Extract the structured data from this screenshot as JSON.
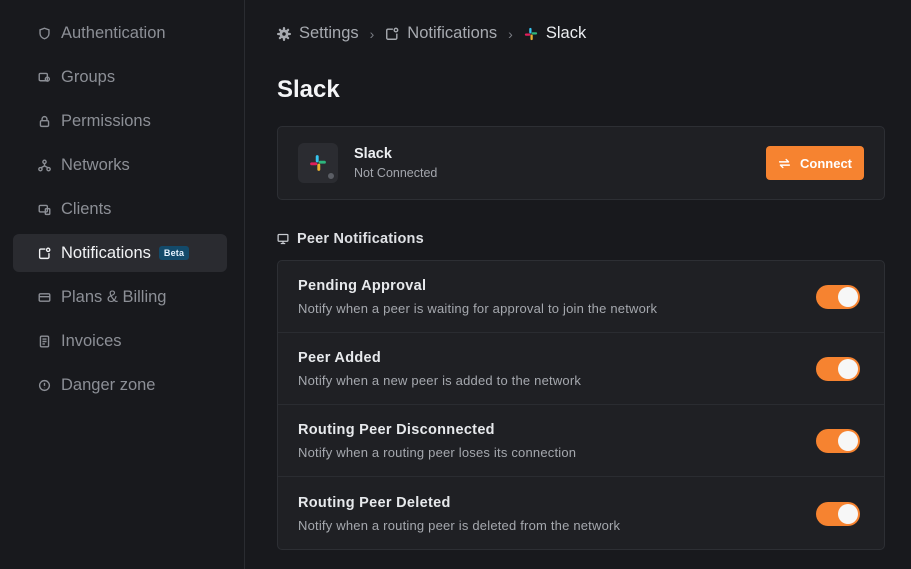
{
  "sidebar": {
    "items": [
      {
        "label": "Authentication",
        "icon": "shield-icon"
      },
      {
        "label": "Groups",
        "icon": "groups-icon"
      },
      {
        "label": "Permissions",
        "icon": "lock-icon"
      },
      {
        "label": "Networks",
        "icon": "network-icon"
      },
      {
        "label": "Clients",
        "icon": "clients-icon"
      },
      {
        "label": "Notifications",
        "icon": "notification-icon",
        "active": true,
        "badge": "Beta"
      },
      {
        "label": "Plans & Billing",
        "icon": "credit-card-icon"
      },
      {
        "label": "Invoices",
        "icon": "invoice-icon"
      },
      {
        "label": "Danger zone",
        "icon": "alert-circle-icon"
      }
    ]
  },
  "breadcrumb": {
    "settings": "Settings",
    "notifications": "Notifications",
    "current": "Slack"
  },
  "page": {
    "title": "Slack"
  },
  "integration": {
    "name": "Slack",
    "status": "Not Connected",
    "connect_label": "Connect"
  },
  "section": {
    "title": "Peer Notifications"
  },
  "notifications": [
    {
      "title": "Pending Approval",
      "description": "Notify when a peer is waiting for approval to join the network",
      "enabled": true
    },
    {
      "title": "Peer Added",
      "description": "Notify when a new peer is added to the network",
      "enabled": true
    },
    {
      "title": "Routing Peer Disconnected",
      "description": "Notify when a routing peer loses its connection",
      "enabled": true
    },
    {
      "title": "Routing Peer Deleted",
      "description": "Notify when a routing peer is deleted from the network",
      "enabled": true
    }
  ],
  "colors": {
    "accent": "#f68330",
    "background": "#18191d",
    "card": "#1f2024",
    "badge": "#134a6a"
  }
}
